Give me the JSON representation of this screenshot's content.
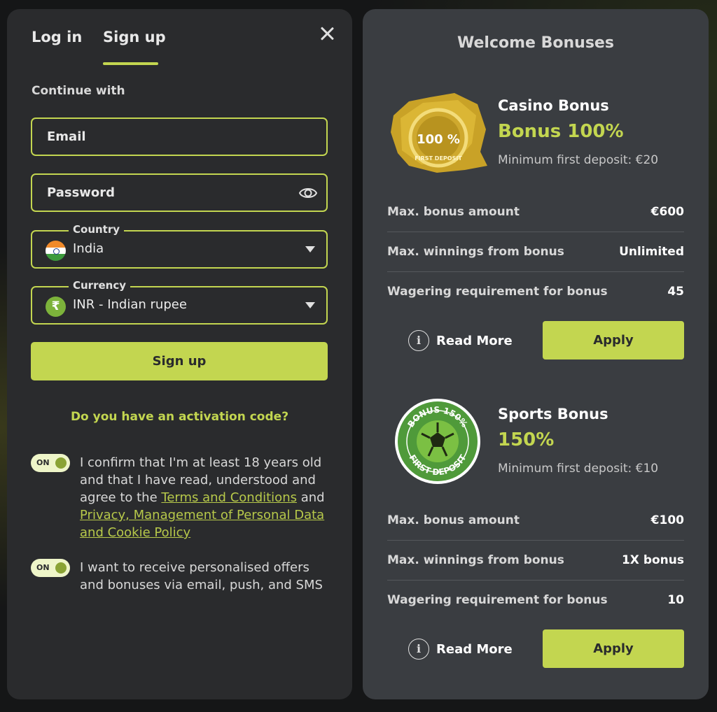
{
  "tabs": {
    "login": "Log in",
    "signup": "Sign up"
  },
  "form": {
    "continue_with": "Continue with",
    "email_placeholder": "Email",
    "password_placeholder": "Password",
    "country": {
      "label": "Country",
      "value": "India"
    },
    "currency": {
      "label": "Currency",
      "value": "INR - Indian rupee",
      "symbol": "₹"
    },
    "signup_button": "Sign up",
    "activation_link": "Do you have an activation code?"
  },
  "consents": [
    {
      "state": "ON",
      "text_before": "I confirm that I'm at least 18 years old and that I have read, understood and agree to the ",
      "link1": "Terms and Conditions",
      "text_middle": " and ",
      "link2": "Privacy, Management of Personal Data and Cookie Policy"
    },
    {
      "state": "ON",
      "text": "I want to receive personalised offers and bonuses via email, push, and SMS"
    }
  ],
  "bonuses": {
    "title": "Welcome Bonuses",
    "casino": {
      "badge_percent": "100 %",
      "badge_text": "FIRST DEPOSIT",
      "title": "Casino Bonus",
      "highlight": "Bonus 100%",
      "min_deposit": "Minimum first deposit: €20",
      "rows": [
        {
          "label": "Max. bonus amount",
          "value": "€600"
        },
        {
          "label": "Max. winnings from bonus",
          "value": "Unlimited"
        },
        {
          "label": "Wagering requirement for bonus",
          "value": "45"
        }
      ],
      "read_more": "Read More",
      "apply": "Apply"
    },
    "sports": {
      "badge_top": "BONUS 150%",
      "badge_bottom": "FIRST DEPOSIT",
      "title": "Sports Bonus",
      "highlight": "150%",
      "min_deposit": "Minimum first deposit: €10",
      "rows": [
        {
          "label": "Max. bonus amount",
          "value": "€100"
        },
        {
          "label": "Max. winnings from bonus",
          "value": "1X bonus"
        },
        {
          "label": "Wagering requirement for bonus",
          "value": "10"
        }
      ],
      "read_more": "Read More",
      "apply": "Apply"
    }
  },
  "colors": {
    "accent": "#c3d650",
    "left_panel": "#2a2b2d",
    "right_panel": "#3a3d41"
  }
}
